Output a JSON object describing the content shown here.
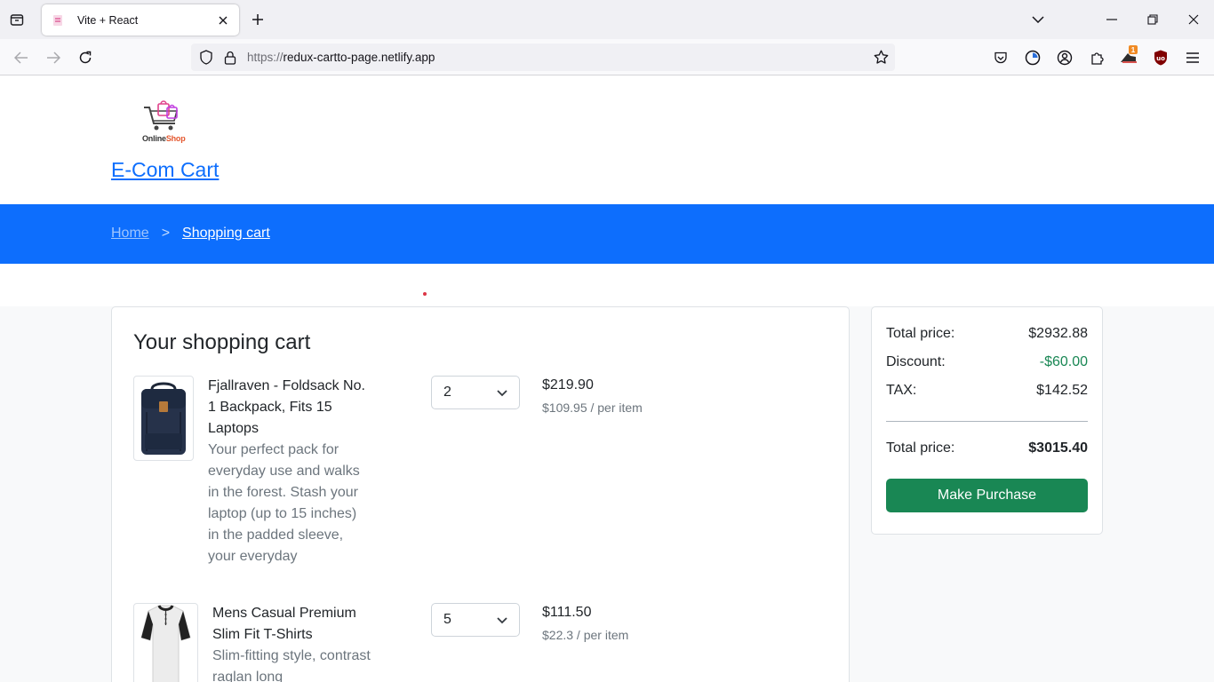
{
  "browser": {
    "tab_title": "Vite + React",
    "url_proto": "https://",
    "url_host": "redux-cartto-page.netlify.app",
    "ext_badge": "1"
  },
  "site": {
    "logo_text_a": "Online",
    "logo_text_b": "Shop",
    "brand": "E-Com Cart"
  },
  "breadcrumb": {
    "home": "Home",
    "separator": ">",
    "current": "Shopping cart"
  },
  "cart": {
    "title": "Your shopping cart",
    "items": [
      {
        "name": "Fjallraven - Foldsack No. 1 Backpack, Fits 15 Laptops",
        "description": "Your perfect pack for everyday use and walks in the forest. Stash your laptop (up to 15 inches) in the padded sleeve, your everyday",
        "quantity": "2",
        "price": "$219.90",
        "per_item": "$109.95 / per item"
      },
      {
        "name": "Mens Casual Premium Slim Fit T-Shirts",
        "description": "Slim-fitting style, contrast raglan long",
        "quantity": "5",
        "price": "$111.50",
        "per_item": "$22.3 / per item"
      }
    ]
  },
  "summary": {
    "total_label": "Total price:",
    "total_value": "$2932.88",
    "discount_label": "Discount:",
    "discount_value": "-$60.00",
    "tax_label": "TAX:",
    "tax_value": "$142.52",
    "grand_label": "Total price:",
    "grand_value": "$3015.40",
    "purchase_button": "Make Purchase"
  },
  "colors": {
    "primary": "#0d6efd",
    "success": "#198754"
  }
}
